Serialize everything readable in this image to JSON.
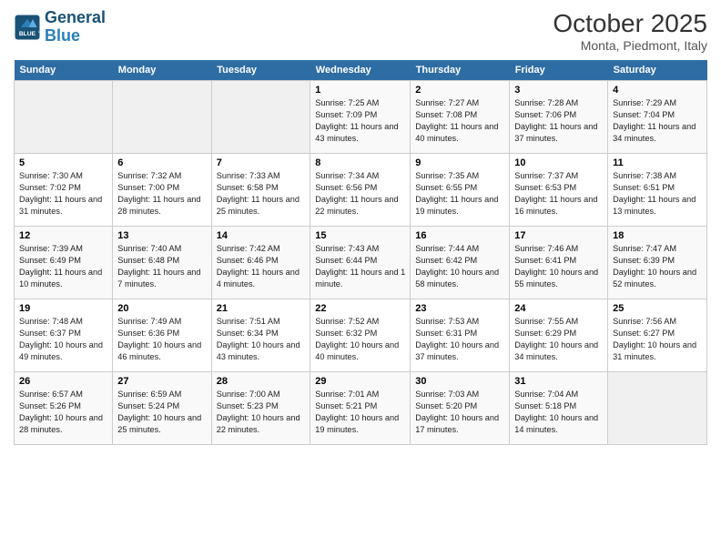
{
  "header": {
    "logo_line1": "General",
    "logo_line2": "Blue",
    "month": "October 2025",
    "location": "Monta, Piedmont, Italy"
  },
  "days_of_week": [
    "Sunday",
    "Monday",
    "Tuesday",
    "Wednesday",
    "Thursday",
    "Friday",
    "Saturday"
  ],
  "weeks": [
    [
      {
        "num": "",
        "info": ""
      },
      {
        "num": "",
        "info": ""
      },
      {
        "num": "",
        "info": ""
      },
      {
        "num": "1",
        "info": "Sunrise: 7:25 AM\nSunset: 7:09 PM\nDaylight: 11 hours and 43 minutes."
      },
      {
        "num": "2",
        "info": "Sunrise: 7:27 AM\nSunset: 7:08 PM\nDaylight: 11 hours and 40 minutes."
      },
      {
        "num": "3",
        "info": "Sunrise: 7:28 AM\nSunset: 7:06 PM\nDaylight: 11 hours and 37 minutes."
      },
      {
        "num": "4",
        "info": "Sunrise: 7:29 AM\nSunset: 7:04 PM\nDaylight: 11 hours and 34 minutes."
      }
    ],
    [
      {
        "num": "5",
        "info": "Sunrise: 7:30 AM\nSunset: 7:02 PM\nDaylight: 11 hours and 31 minutes."
      },
      {
        "num": "6",
        "info": "Sunrise: 7:32 AM\nSunset: 7:00 PM\nDaylight: 11 hours and 28 minutes."
      },
      {
        "num": "7",
        "info": "Sunrise: 7:33 AM\nSunset: 6:58 PM\nDaylight: 11 hours and 25 minutes."
      },
      {
        "num": "8",
        "info": "Sunrise: 7:34 AM\nSunset: 6:56 PM\nDaylight: 11 hours and 22 minutes."
      },
      {
        "num": "9",
        "info": "Sunrise: 7:35 AM\nSunset: 6:55 PM\nDaylight: 11 hours and 19 minutes."
      },
      {
        "num": "10",
        "info": "Sunrise: 7:37 AM\nSunset: 6:53 PM\nDaylight: 11 hours and 16 minutes."
      },
      {
        "num": "11",
        "info": "Sunrise: 7:38 AM\nSunset: 6:51 PM\nDaylight: 11 hours and 13 minutes."
      }
    ],
    [
      {
        "num": "12",
        "info": "Sunrise: 7:39 AM\nSunset: 6:49 PM\nDaylight: 11 hours and 10 minutes."
      },
      {
        "num": "13",
        "info": "Sunrise: 7:40 AM\nSunset: 6:48 PM\nDaylight: 11 hours and 7 minutes."
      },
      {
        "num": "14",
        "info": "Sunrise: 7:42 AM\nSunset: 6:46 PM\nDaylight: 11 hours and 4 minutes."
      },
      {
        "num": "15",
        "info": "Sunrise: 7:43 AM\nSunset: 6:44 PM\nDaylight: 11 hours and 1 minute."
      },
      {
        "num": "16",
        "info": "Sunrise: 7:44 AM\nSunset: 6:42 PM\nDaylight: 10 hours and 58 minutes."
      },
      {
        "num": "17",
        "info": "Sunrise: 7:46 AM\nSunset: 6:41 PM\nDaylight: 10 hours and 55 minutes."
      },
      {
        "num": "18",
        "info": "Sunrise: 7:47 AM\nSunset: 6:39 PM\nDaylight: 10 hours and 52 minutes."
      }
    ],
    [
      {
        "num": "19",
        "info": "Sunrise: 7:48 AM\nSunset: 6:37 PM\nDaylight: 10 hours and 49 minutes."
      },
      {
        "num": "20",
        "info": "Sunrise: 7:49 AM\nSunset: 6:36 PM\nDaylight: 10 hours and 46 minutes."
      },
      {
        "num": "21",
        "info": "Sunrise: 7:51 AM\nSunset: 6:34 PM\nDaylight: 10 hours and 43 minutes."
      },
      {
        "num": "22",
        "info": "Sunrise: 7:52 AM\nSunset: 6:32 PM\nDaylight: 10 hours and 40 minutes."
      },
      {
        "num": "23",
        "info": "Sunrise: 7:53 AM\nSunset: 6:31 PM\nDaylight: 10 hours and 37 minutes."
      },
      {
        "num": "24",
        "info": "Sunrise: 7:55 AM\nSunset: 6:29 PM\nDaylight: 10 hours and 34 minutes."
      },
      {
        "num": "25",
        "info": "Sunrise: 7:56 AM\nSunset: 6:27 PM\nDaylight: 10 hours and 31 minutes."
      }
    ],
    [
      {
        "num": "26",
        "info": "Sunrise: 6:57 AM\nSunset: 5:26 PM\nDaylight: 10 hours and 28 minutes."
      },
      {
        "num": "27",
        "info": "Sunrise: 6:59 AM\nSunset: 5:24 PM\nDaylight: 10 hours and 25 minutes."
      },
      {
        "num": "28",
        "info": "Sunrise: 7:00 AM\nSunset: 5:23 PM\nDaylight: 10 hours and 22 minutes."
      },
      {
        "num": "29",
        "info": "Sunrise: 7:01 AM\nSunset: 5:21 PM\nDaylight: 10 hours and 19 minutes."
      },
      {
        "num": "30",
        "info": "Sunrise: 7:03 AM\nSunset: 5:20 PM\nDaylight: 10 hours and 17 minutes."
      },
      {
        "num": "31",
        "info": "Sunrise: 7:04 AM\nSunset: 5:18 PM\nDaylight: 10 hours and 14 minutes."
      },
      {
        "num": "",
        "info": ""
      }
    ]
  ]
}
